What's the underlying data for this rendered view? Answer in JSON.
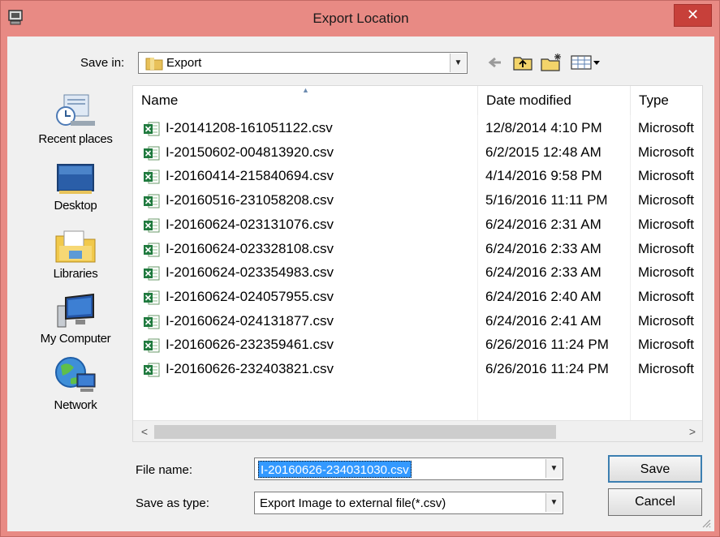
{
  "window": {
    "title": "Export Location",
    "close_label": "✕"
  },
  "toolbar": {
    "save_in_label": "Save in:",
    "save_in_value": "Export",
    "icons": [
      "back-arrow-icon",
      "up-folder-icon",
      "new-folder-icon",
      "view-menu-icon"
    ]
  },
  "places": [
    {
      "label": "Recent places",
      "icon": "recent-places-icon"
    },
    {
      "label": "Desktop",
      "icon": "desktop-icon"
    },
    {
      "label": "Libraries",
      "icon": "libraries-icon"
    },
    {
      "label": "My Computer",
      "icon": "computer-icon"
    },
    {
      "label": "Network",
      "icon": "network-icon"
    }
  ],
  "file_list": {
    "columns": [
      "Name",
      "Date modified",
      "Type"
    ],
    "sort_indicator": "▲",
    "rows": [
      {
        "name": "I-20141208-161051122.csv",
        "date": "12/8/2014 4:10 PM",
        "type": "Microsoft"
      },
      {
        "name": "I-20150602-004813920.csv",
        "date": "6/2/2015 12:48 AM",
        "type": "Microsoft"
      },
      {
        "name": "I-20160414-215840694.csv",
        "date": "4/14/2016 9:58 PM",
        "type": "Microsoft"
      },
      {
        "name": "I-20160516-231058208.csv",
        "date": "5/16/2016 11:11 PM",
        "type": "Microsoft"
      },
      {
        "name": "I-20160624-023131076.csv",
        "date": "6/24/2016 2:31 AM",
        "type": "Microsoft"
      },
      {
        "name": "I-20160624-023328108.csv",
        "date": "6/24/2016 2:33 AM",
        "type": "Microsoft"
      },
      {
        "name": "I-20160624-023354983.csv",
        "date": "6/24/2016 2:33 AM",
        "type": "Microsoft"
      },
      {
        "name": "I-20160624-024057955.csv",
        "date": "6/24/2016 2:40 AM",
        "type": "Microsoft"
      },
      {
        "name": "I-20160624-024131877.csv",
        "date": "6/24/2016 2:41 AM",
        "type": "Microsoft"
      },
      {
        "name": "I-20160626-232359461.csv",
        "date": "6/26/2016 11:24 PM",
        "type": "Microsoft"
      },
      {
        "name": "I-20160626-232403821.csv",
        "date": "6/26/2016 11:24 PM",
        "type": "Microsoft"
      }
    ]
  },
  "scrollbar": {
    "left": "<",
    "right": ">"
  },
  "form": {
    "file_name_label": "File name:",
    "file_name_value": "I-20160626-234031030.csv",
    "save_as_type_label": "Save as type:",
    "save_as_type_value": "Export Image to external file(*.csv)"
  },
  "buttons": {
    "save": "Save",
    "cancel": "Cancel"
  },
  "colors": {
    "title_bar": "#e88a84",
    "close_button": "#c7403a",
    "selection": "#3399ff"
  }
}
